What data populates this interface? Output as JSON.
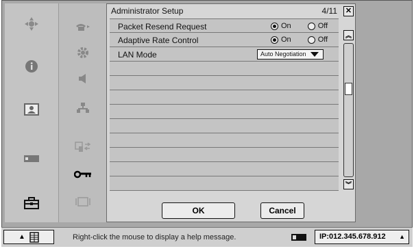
{
  "panel": {
    "title": "Administrator Setup",
    "page_count": "4/11"
  },
  "rows": [
    {
      "label": "Packet Resend Request",
      "type": "radio",
      "options": [
        "On",
        "Off"
      ],
      "selected": "On"
    },
    {
      "label": "Adaptive Rate Control",
      "type": "radio",
      "options": [
        "On",
        "Off"
      ],
      "selected": "On"
    },
    {
      "label": "LAN Mode",
      "type": "select",
      "value": "Auto Negotiation"
    }
  ],
  "buttons": {
    "ok_label": "OK",
    "cancel_label": "Cancel"
  },
  "status": {
    "help_text": "Right-click the mouse to display a help message.",
    "ip_label": "IP:012.345.678.912"
  },
  "icons": {
    "left_rail": [
      "dpad-icon",
      "info-icon",
      "picture-icon",
      "device-icon",
      "toolbox-icon"
    ],
    "mid_rail": [
      "phone-icon",
      "gear-icon",
      "speaker-icon",
      "network-icon",
      "transfer-icon",
      "key-icon",
      "frame-icon"
    ]
  },
  "colors": {
    "background": "#a8a8a8",
    "panel": "#d6d6d6",
    "row": "#c4c4c4",
    "active_icon": "#000000"
  },
  "scrollbar": {
    "position": 0.0
  }
}
